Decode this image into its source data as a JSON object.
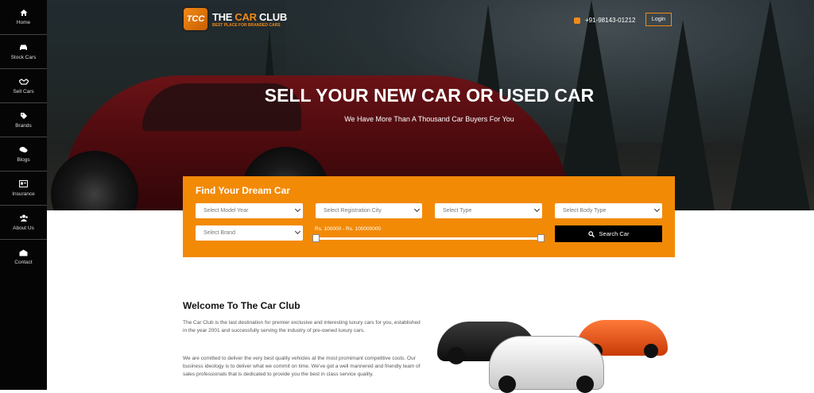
{
  "sidebar": {
    "items": [
      {
        "label": "Home",
        "icon": "home-icon"
      },
      {
        "label": "Stock Cars",
        "icon": "car-icon"
      },
      {
        "label": "Sell Cars",
        "icon": "handshake-icon"
      },
      {
        "label": "Brands",
        "icon": "tag-icon"
      },
      {
        "label": "Blogs",
        "icon": "comments-icon"
      },
      {
        "label": "Insurance",
        "icon": "card-icon"
      },
      {
        "label": "About Us",
        "icon": "users-icon"
      },
      {
        "label": "Contact",
        "icon": "envelope-icon"
      }
    ]
  },
  "header": {
    "logo_badge": "TCC",
    "logo_title_1": "THE ",
    "logo_title_2": "CAR",
    "logo_title_3": " CLUB",
    "logo_tagline": "BEST PLACE FOR BRANDED CARS",
    "phone": "+91-98143-01212",
    "login_label": "Login"
  },
  "hero": {
    "title": "SELL YOUR NEW CAR OR USED CAR",
    "subtitle": "We Have More Than A Thousand Car Buyers For You"
  },
  "search": {
    "title": "Find Your Dream Car",
    "model_year": "Select Model Year",
    "registration_city": "Select Registration City",
    "type": "Select Type",
    "body_type": "Select Body Type",
    "brand": "Select Brand",
    "price_range": "Rs. 100000 - Rs. 100000000",
    "button_label": "Search Car"
  },
  "welcome": {
    "title": "Welcome To The Car Club",
    "para1": "The Car Club is the last destination for premier exclusive and interesting luxury cars for you, established in the year 2001 and successfully serving the industry of pre-owned luxury cars.",
    "para2": "We are comitted to deliver the very best quality vehicles at the most promimant competitive costs. Our business ideology is to deliver what we commit on time. We've got a well mannered and friendly team of sales professionals that is dedicated to provide you the best in class service quality."
  },
  "colors": {
    "accent": "#f28a06",
    "sidebar_bg": "#050505"
  }
}
